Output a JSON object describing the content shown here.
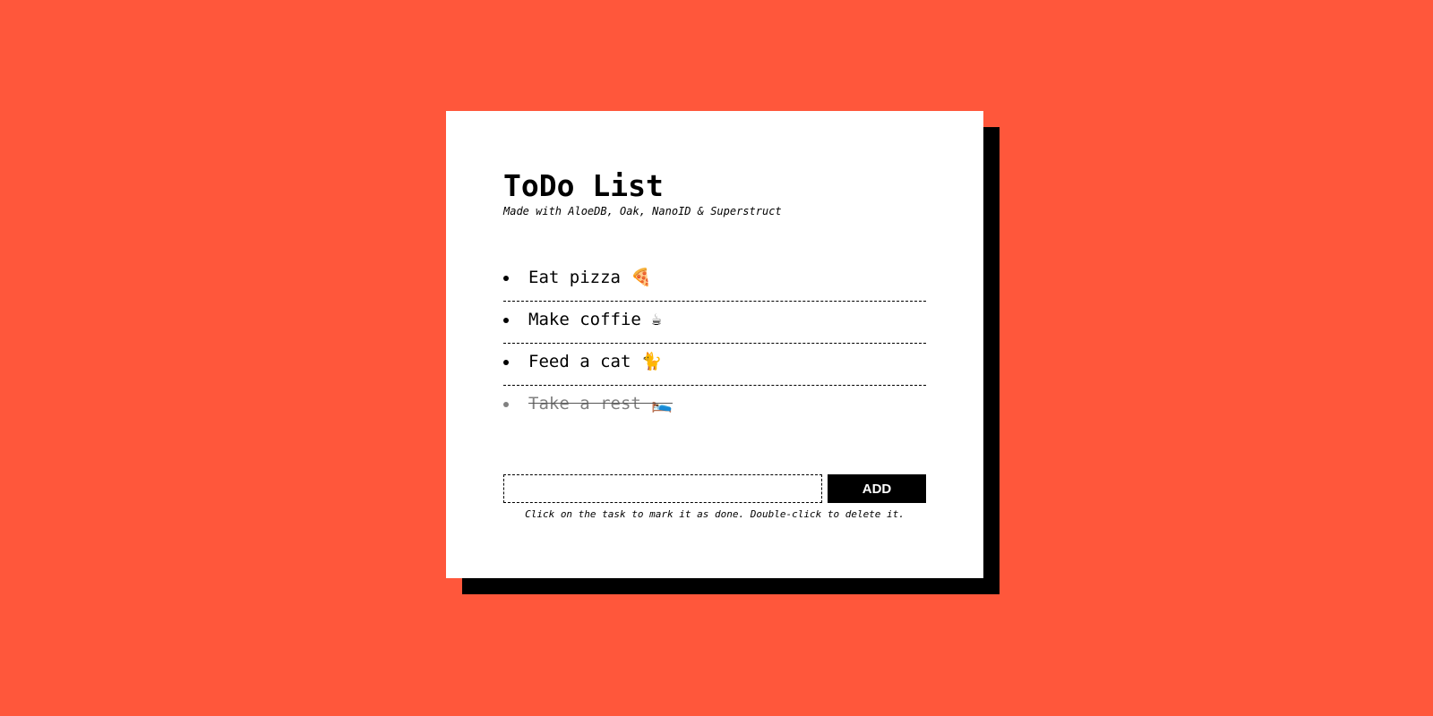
{
  "colors": {
    "background": "#FF573B",
    "card": "#FFFFFF",
    "shadow": "#000000",
    "done_text": "#808080"
  },
  "app": {
    "title": "ToDo List",
    "subtitle": "Made with AloeDB, Oak, NanoID & Superstruct"
  },
  "todos": [
    {
      "text": "Eat pizza 🍕",
      "done": false
    },
    {
      "text": "Make coffie ☕",
      "done": false
    },
    {
      "text": "Feed a cat 🐈",
      "done": false
    },
    {
      "text": "Take a rest 🛌",
      "done": true
    }
  ],
  "form": {
    "input_value": "",
    "input_placeholder": "",
    "add_label": "ADD",
    "hint": "Click on the task to mark it as done. Double-click to delete it."
  }
}
